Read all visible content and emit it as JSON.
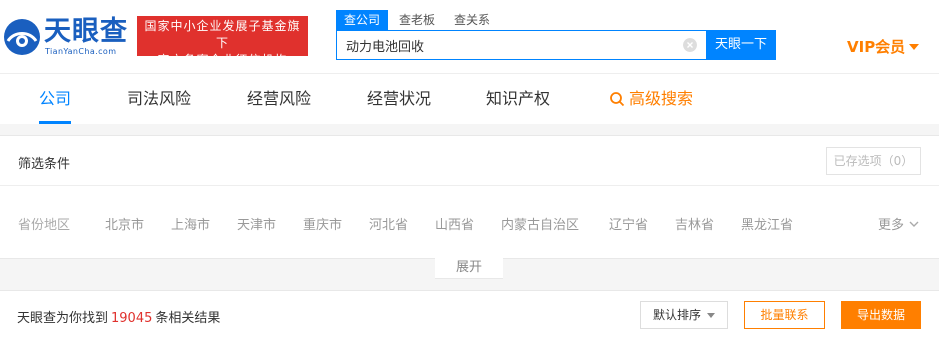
{
  "header": {
    "logo_cn": "天眼查",
    "logo_en": "TianYanCha.com",
    "gov_badge_line1": "国家中小企业发展子基金旗下",
    "gov_badge_line2": "官方备案企业征信机构",
    "search_tabs": [
      "查公司",
      "查老板",
      "查关系"
    ],
    "search_value": "动力电池回收",
    "search_button": "天眼一下",
    "vip_label": "VIP会员"
  },
  "nav": {
    "items": [
      "公司",
      "司法风险",
      "经营风险",
      "经营状况",
      "知识产权"
    ],
    "advanced_search": "高级搜索"
  },
  "filter": {
    "title": "筛选条件",
    "saved_options": "已存选项（0）",
    "region_label": "省份地区",
    "regions": [
      "北京市",
      "上海市",
      "天津市",
      "重庆市",
      "河北省",
      "山西省",
      "内蒙古自治区",
      "辽宁省",
      "吉林省",
      "黑龙江省"
    ],
    "more": "更多",
    "expand": "展开"
  },
  "results": {
    "prefix": "天眼查为你找到",
    "count": "19045",
    "suffix": "条相关结果",
    "sort": "默认排序",
    "bulk_contact": "批量联系",
    "export": "导出数据"
  },
  "colors": {
    "brand_blue": "#0084ff",
    "accent_orange": "#ff7f00",
    "badge_red": "#e0312d"
  }
}
